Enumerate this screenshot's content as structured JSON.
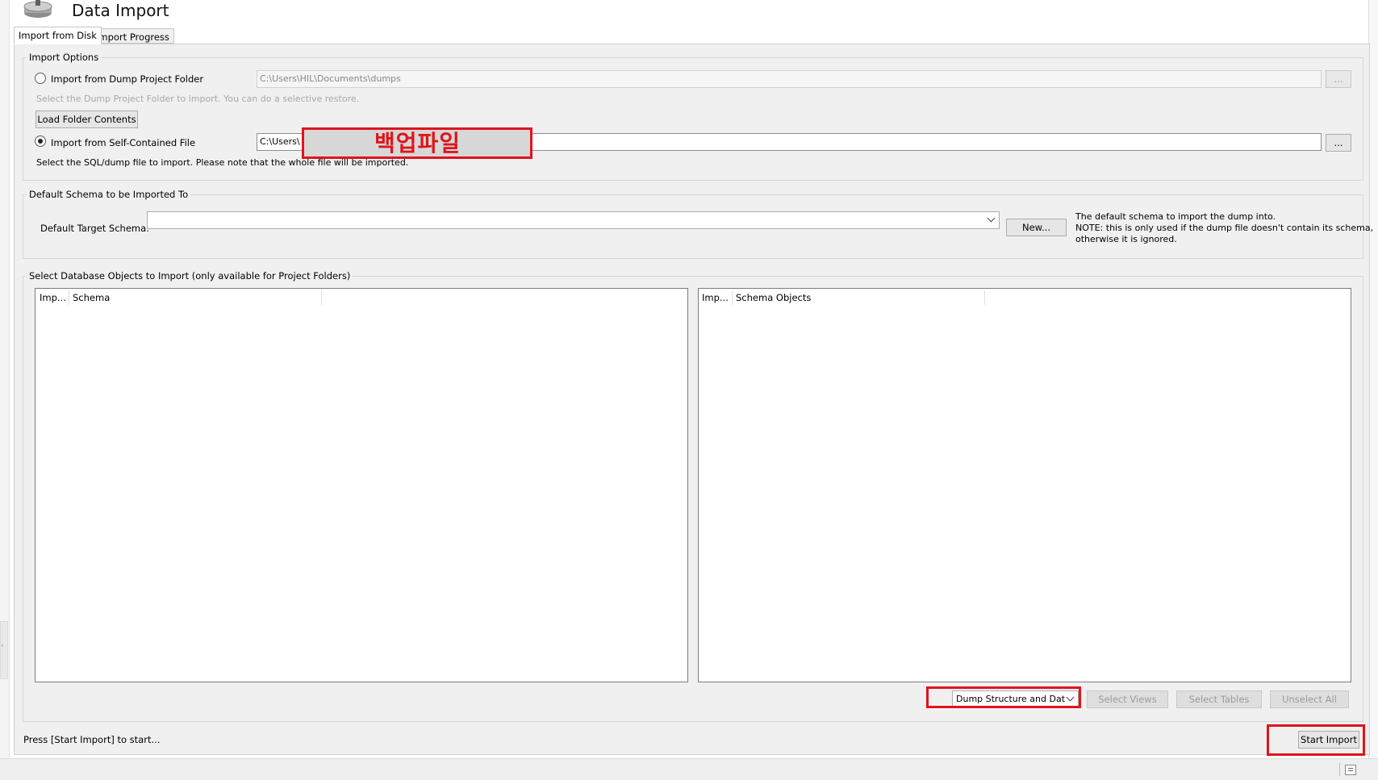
{
  "header": {
    "title": "Data Import",
    "icon": "database-import-icon"
  },
  "tabs": [
    {
      "label": "Import from Disk",
      "active": true
    },
    {
      "label": "Import Progress",
      "active": false
    }
  ],
  "import_options": {
    "title": "Import Options",
    "folder_option": {
      "label": "Import from Dump Project Folder",
      "path": "C:\\Users\\HIL\\Documents\\dumps",
      "hint": "Select the Dump Project Folder to import. You can do a selective restore.",
      "load_button": "Load Folder Contents",
      "browse": "..."
    },
    "file_option": {
      "label": "Import from Self-Contained File",
      "path": "C:\\Users\\",
      "hint": "Select the SQL/dump file to import. Please note that the whole file will be imported.",
      "browse": "...",
      "annotation": "백업파일"
    }
  },
  "default_schema": {
    "title": "Default Schema to be Imported To",
    "label": "Default Target Schema:",
    "value": "",
    "new_button": "New...",
    "note_line1": "The default schema to import the dump into.",
    "note_line2": "NOTE: this is only used if the dump file doesn't contain its schema,",
    "note_line3": "otherwise it is ignored."
  },
  "objects": {
    "title": "Select Database Objects to Import (only available for Project Folders)",
    "left_columns": [
      "Imp...",
      "Schema"
    ],
    "right_columns": [
      "Imp...",
      "Schema Objects"
    ],
    "dump_mode": "Dump Structure and Dat",
    "select_views": "Select Views",
    "select_tables": "Select Tables",
    "unselect_all": "Unselect All"
  },
  "footer": {
    "status": "Press [Start Import] to start...",
    "start_button": "Start Import"
  },
  "colors": {
    "annotation": "#e0141c",
    "panel": "#f0f0f0"
  }
}
